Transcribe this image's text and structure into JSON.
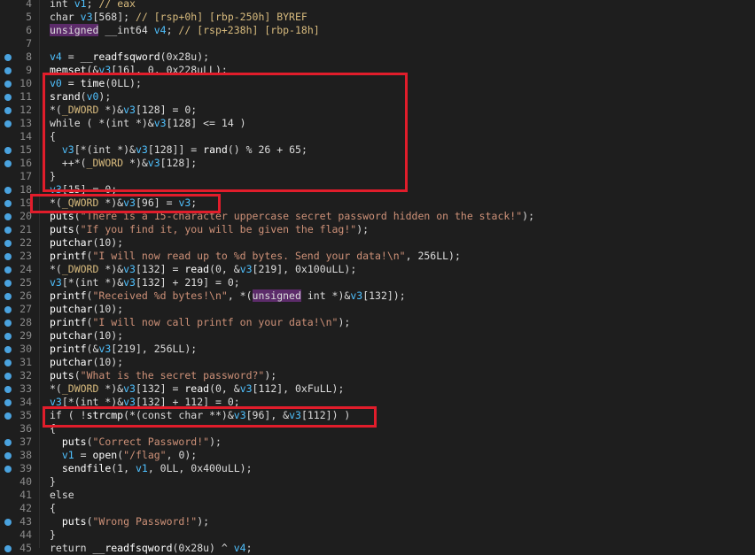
{
  "lines": [
    {
      "n": "4",
      "bp": false,
      "segs": [
        [
          "ty",
          "int"
        ],
        [
          "p",
          " "
        ],
        [
          "var",
          "v1"
        ],
        [
          "p",
          "; "
        ],
        [
          "com",
          "// eax"
        ]
      ]
    },
    {
      "n": "5",
      "bp": false,
      "segs": [
        [
          "ty",
          "char"
        ],
        [
          "p",
          " "
        ],
        [
          "var",
          "v3"
        ],
        [
          "p",
          "[568]; "
        ],
        [
          "com",
          "// [rsp+0h] [rbp-250h] BYREF"
        ]
      ]
    },
    {
      "n": "6",
      "bp": false,
      "segs": [
        [
          "hl",
          "unsigned"
        ],
        [
          "p",
          " __int64 "
        ],
        [
          "var",
          "v4"
        ],
        [
          "p",
          "; "
        ],
        [
          "com",
          "// [rsp+238h] [rbp-18h]"
        ]
      ]
    },
    {
      "n": "7",
      "bp": false,
      "segs": []
    },
    {
      "n": "8",
      "bp": true,
      "segs": [
        [
          "var",
          "v4"
        ],
        [
          "p",
          " = "
        ],
        [
          "fn",
          "__readfsqword"
        ],
        [
          "p",
          "(0x28u);"
        ]
      ]
    },
    {
      "n": "9",
      "bp": true,
      "segs": [
        [
          "fn",
          "memset"
        ],
        [
          "p",
          "(&"
        ],
        [
          "var",
          "v3"
        ],
        [
          "p",
          "[16], 0, 0x228uLL);"
        ]
      ]
    },
    {
      "n": "10",
      "bp": true,
      "segs": [
        [
          "var",
          "v0"
        ],
        [
          "p",
          " = "
        ],
        [
          "fn",
          "time"
        ],
        [
          "p",
          "(0LL);"
        ]
      ]
    },
    {
      "n": "11",
      "bp": true,
      "segs": [
        [
          "fn",
          "srand"
        ],
        [
          "p",
          "("
        ],
        [
          "var",
          "v0"
        ],
        [
          "p",
          ");"
        ]
      ]
    },
    {
      "n": "12",
      "bp": true,
      "segs": [
        [
          "p",
          "*("
        ],
        [
          "cast",
          "_DWORD"
        ],
        [
          "p",
          " *)&"
        ],
        [
          "var",
          "v3"
        ],
        [
          "p",
          "[128] = 0;"
        ]
      ]
    },
    {
      "n": "13",
      "bp": true,
      "segs": [
        [
          "kw",
          "while"
        ],
        [
          "p",
          " ( *("
        ],
        [
          "ty",
          "int"
        ],
        [
          "p",
          " *)&"
        ],
        [
          "var",
          "v3"
        ],
        [
          "p",
          "[128] <= 14 )"
        ]
      ]
    },
    {
      "n": "14",
      "bp": false,
      "segs": [
        [
          "p",
          "{"
        ]
      ]
    },
    {
      "n": "15",
      "bp": true,
      "segs": [
        [
          "p",
          "  "
        ],
        [
          "var",
          "v3"
        ],
        [
          "p",
          "[*("
        ],
        [
          "ty",
          "int"
        ],
        [
          "p",
          " *)&"
        ],
        [
          "var",
          "v3"
        ],
        [
          "p",
          "[128]] = "
        ],
        [
          "fn",
          "rand"
        ],
        [
          "p",
          "() % 26 + 65;"
        ]
      ]
    },
    {
      "n": "16",
      "bp": true,
      "segs": [
        [
          "p",
          "  ++*("
        ],
        [
          "cast",
          "_DWORD"
        ],
        [
          "p",
          " *)&"
        ],
        [
          "var",
          "v3"
        ],
        [
          "p",
          "[128];"
        ]
      ]
    },
    {
      "n": "17",
      "bp": false,
      "segs": [
        [
          "p",
          "}"
        ]
      ]
    },
    {
      "n": "18",
      "bp": true,
      "segs": [
        [
          "var",
          "v3"
        ],
        [
          "p",
          "[15] = 0;"
        ]
      ]
    },
    {
      "n": "19",
      "bp": true,
      "segs": [
        [
          "p",
          "*("
        ],
        [
          "cast",
          "_QWORD"
        ],
        [
          "p",
          " *)&"
        ],
        [
          "var",
          "v3"
        ],
        [
          "p",
          "[96] = "
        ],
        [
          "var",
          "v3"
        ],
        [
          "p",
          ";"
        ]
      ]
    },
    {
      "n": "20",
      "bp": true,
      "segs": [
        [
          "fn",
          "puts"
        ],
        [
          "p",
          "("
        ],
        [
          "str",
          "\"There is a 15-character uppercase secret password hidden on the stack!\""
        ],
        [
          "p",
          ");"
        ]
      ]
    },
    {
      "n": "21",
      "bp": true,
      "segs": [
        [
          "fn",
          "puts"
        ],
        [
          "p",
          "("
        ],
        [
          "str",
          "\"If you find it, you will be given the flag!\""
        ],
        [
          "p",
          ");"
        ]
      ]
    },
    {
      "n": "22",
      "bp": true,
      "segs": [
        [
          "fn",
          "putchar"
        ],
        [
          "p",
          "(10);"
        ]
      ]
    },
    {
      "n": "23",
      "bp": true,
      "segs": [
        [
          "fn",
          "printf"
        ],
        [
          "p",
          "("
        ],
        [
          "str",
          "\"I will now read up to %d bytes. Send your data!\\n\""
        ],
        [
          "p",
          ", 256LL);"
        ]
      ]
    },
    {
      "n": "24",
      "bp": true,
      "segs": [
        [
          "p",
          "*("
        ],
        [
          "cast",
          "_DWORD"
        ],
        [
          "p",
          " *)&"
        ],
        [
          "var",
          "v3"
        ],
        [
          "p",
          "[132] = "
        ],
        [
          "fn",
          "read"
        ],
        [
          "p",
          "(0, &"
        ],
        [
          "var",
          "v3"
        ],
        [
          "p",
          "[219], 0x100uLL);"
        ]
      ]
    },
    {
      "n": "25",
      "bp": true,
      "segs": [
        [
          "var",
          "v3"
        ],
        [
          "p",
          "[*("
        ],
        [
          "ty",
          "int"
        ],
        [
          "p",
          " *)&"
        ],
        [
          "var",
          "v3"
        ],
        [
          "p",
          "[132] + 219] = 0;"
        ]
      ]
    },
    {
      "n": "26",
      "bp": true,
      "segs": [
        [
          "fn",
          "printf"
        ],
        [
          "p",
          "("
        ],
        [
          "str",
          "\"Received %d bytes!\\n\""
        ],
        [
          "p",
          ", *("
        ],
        [
          "hl",
          "unsigned"
        ],
        [
          "p",
          " "
        ],
        [
          "ty",
          "int"
        ],
        [
          "p",
          " *)&"
        ],
        [
          "var",
          "v3"
        ],
        [
          "p",
          "[132]);"
        ]
      ]
    },
    {
      "n": "27",
      "bp": true,
      "segs": [
        [
          "fn",
          "putchar"
        ],
        [
          "p",
          "(10);"
        ]
      ]
    },
    {
      "n": "28",
      "bp": true,
      "segs": [
        [
          "fn",
          "printf"
        ],
        [
          "p",
          "("
        ],
        [
          "str",
          "\"I will now call printf on your data!\\n\""
        ],
        [
          "p",
          ");"
        ]
      ]
    },
    {
      "n": "29",
      "bp": true,
      "segs": [
        [
          "fn",
          "putchar"
        ],
        [
          "p",
          "(10);"
        ]
      ]
    },
    {
      "n": "30",
      "bp": true,
      "segs": [
        [
          "fn",
          "printf"
        ],
        [
          "p",
          "(&"
        ],
        [
          "var",
          "v3"
        ],
        [
          "p",
          "[219], 256LL);"
        ]
      ]
    },
    {
      "n": "31",
      "bp": true,
      "segs": [
        [
          "fn",
          "putchar"
        ],
        [
          "p",
          "(10);"
        ]
      ]
    },
    {
      "n": "32",
      "bp": true,
      "segs": [
        [
          "fn",
          "puts"
        ],
        [
          "p",
          "("
        ],
        [
          "str",
          "\"What is the secret password?\""
        ],
        [
          "p",
          ");"
        ]
      ]
    },
    {
      "n": "33",
      "bp": true,
      "segs": [
        [
          "p",
          "*("
        ],
        [
          "cast",
          "_DWORD"
        ],
        [
          "p",
          " *)&"
        ],
        [
          "var",
          "v3"
        ],
        [
          "p",
          "[132] = "
        ],
        [
          "fn",
          "read"
        ],
        [
          "p",
          "(0, &"
        ],
        [
          "var",
          "v3"
        ],
        [
          "p",
          "[112], 0xFuLL);"
        ]
      ]
    },
    {
      "n": "34",
      "bp": true,
      "segs": [
        [
          "var",
          "v3"
        ],
        [
          "p",
          "[*("
        ],
        [
          "ty",
          "int"
        ],
        [
          "p",
          " *)&"
        ],
        [
          "var",
          "v3"
        ],
        [
          "p",
          "[132] + 112] = 0;"
        ]
      ]
    },
    {
      "n": "35",
      "bp": true,
      "segs": [
        [
          "kw",
          "if"
        ],
        [
          "p",
          " ( !"
        ],
        [
          "fn",
          "strcmp"
        ],
        [
          "p",
          "(*("
        ],
        [
          "ty",
          "const char"
        ],
        [
          "p",
          " **)&"
        ],
        [
          "var",
          "v3"
        ],
        [
          "p",
          "[96], &"
        ],
        [
          "var",
          "v3"
        ],
        [
          "p",
          "[112]) )"
        ]
      ]
    },
    {
      "n": "36",
      "bp": false,
      "segs": [
        [
          "p",
          "{"
        ]
      ]
    },
    {
      "n": "37",
      "bp": true,
      "segs": [
        [
          "p",
          "  "
        ],
        [
          "fn",
          "puts"
        ],
        [
          "p",
          "("
        ],
        [
          "str",
          "\"Correct Password!\""
        ],
        [
          "p",
          ");"
        ]
      ]
    },
    {
      "n": "38",
      "bp": true,
      "segs": [
        [
          "p",
          "  "
        ],
        [
          "var",
          "v1"
        ],
        [
          "p",
          " = "
        ],
        [
          "fn",
          "open"
        ],
        [
          "p",
          "("
        ],
        [
          "str",
          "\"/flag\""
        ],
        [
          "p",
          ", 0);"
        ]
      ]
    },
    {
      "n": "39",
      "bp": true,
      "segs": [
        [
          "p",
          "  "
        ],
        [
          "fn",
          "sendfile"
        ],
        [
          "p",
          "(1, "
        ],
        [
          "var",
          "v1"
        ],
        [
          "p",
          ", 0LL, 0x400uLL);"
        ]
      ]
    },
    {
      "n": "40",
      "bp": false,
      "segs": [
        [
          "p",
          "}"
        ]
      ]
    },
    {
      "n": "41",
      "bp": false,
      "segs": [
        [
          "kw",
          "else"
        ]
      ]
    },
    {
      "n": "42",
      "bp": false,
      "segs": [
        [
          "p",
          "{"
        ]
      ]
    },
    {
      "n": "43",
      "bp": true,
      "segs": [
        [
          "p",
          "  "
        ],
        [
          "fn",
          "puts"
        ],
        [
          "p",
          "("
        ],
        [
          "str",
          "\"Wrong Password!\""
        ],
        [
          "p",
          ");"
        ]
      ]
    },
    {
      "n": "44",
      "bp": false,
      "segs": [
        [
          "p",
          "}"
        ]
      ]
    },
    {
      "n": "45",
      "bp": true,
      "segs": [
        [
          "kw",
          "return"
        ],
        [
          "p",
          " "
        ],
        [
          "fn",
          "__readfsqword"
        ],
        [
          "p",
          "(0x28u) ^ "
        ],
        [
          "var",
          "v4"
        ],
        [
          "p",
          ";"
        ]
      ]
    }
  ],
  "colors": {
    "background": "#1e1e1e",
    "breakpoint": "#4aa3df",
    "annotation_box": "#e11d2b",
    "string": "#ce9178",
    "variable": "#4fc1ff",
    "highlight": "#5c2b6a"
  }
}
